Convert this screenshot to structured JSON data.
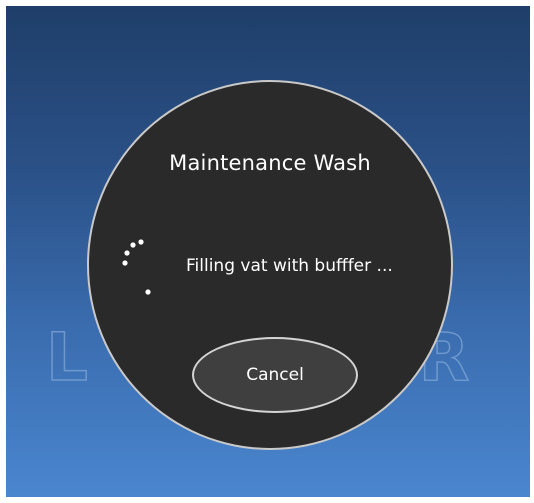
{
  "dialog": {
    "title": "Maintenance Wash",
    "status": "Filling vat with bufffer ...",
    "cancel_label": "Cancel"
  },
  "background": {
    "logo_text": "LUMUR"
  },
  "icons": {
    "spinner": "loading-spinner-icon"
  },
  "colors": {
    "dialog_fill": "#2a2a2a",
    "dialog_border": "#c9c9c9",
    "button_fill": "#3f3f3f",
    "background_top": "#1f3e69",
    "background_bottom": "#4a86cf"
  }
}
